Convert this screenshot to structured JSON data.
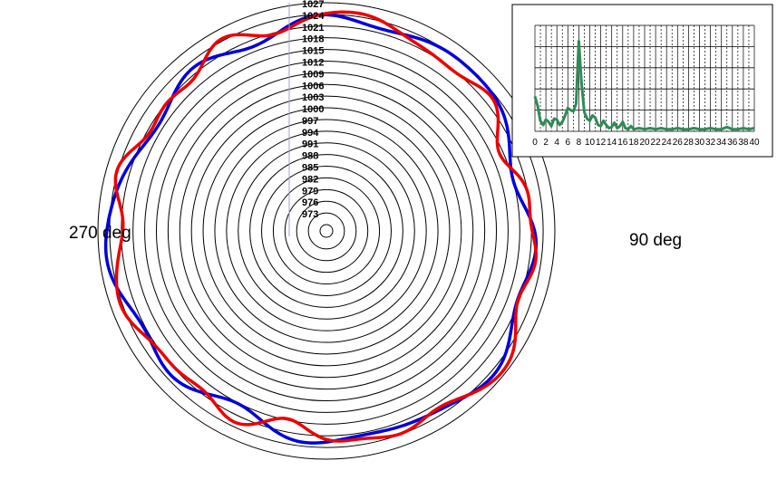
{
  "chart_data": [
    {
      "type": "polar-line",
      "radial_ticks": [
        973,
        976,
        979,
        982,
        985,
        988,
        991,
        994,
        997,
        1000,
        1003,
        1006,
        1009,
        1012,
        1015,
        1018,
        1021,
        1024,
        1027
      ],
      "rlim": [
        970,
        1027
      ],
      "labels": {
        "left": "270 deg",
        "right": "90 deg"
      },
      "series": [
        {
          "color": "#0000dd",
          "base": 1022,
          "harmonics": [
            [
              3,
              1.8,
              0.4
            ],
            [
              8,
              1.3,
              1.3
            ],
            [
              11,
              0.8,
              2.5
            ],
            [
              5,
              0.7,
              4.0
            ]
          ]
        },
        {
          "color": "#ee0000",
          "base": 1022,
          "harmonics": [
            [
              3,
              1.6,
              0.9
            ],
            [
              9,
              1.6,
              0.2
            ],
            [
              14,
              0.8,
              1.7
            ],
            [
              2,
              0.9,
              2.8
            ],
            [
              17,
              0.5,
              4.1
            ]
          ]
        }
      ]
    },
    {
      "type": "line",
      "x_ticks": [
        0,
        2,
        4,
        6,
        8,
        10,
        12,
        14,
        16,
        18,
        20,
        22,
        24,
        26,
        28,
        30,
        32,
        34,
        36,
        38,
        40
      ],
      "xlim": [
        0,
        40
      ],
      "ylim": [
        0,
        10
      ],
      "color": "#2e8b57",
      "x": [
        0,
        0.5,
        1,
        1.5,
        2,
        2.5,
        3,
        3.5,
        4,
        4.5,
        5,
        5.5,
        6,
        6.5,
        7,
        7.5,
        8,
        8.5,
        9,
        9.5,
        10,
        10.5,
        11,
        11.5,
        12,
        12.5,
        13,
        13.5,
        14,
        14.5,
        15,
        15.5,
        16,
        16.5,
        17,
        17.5,
        18,
        19,
        20,
        21,
        22,
        23,
        24,
        25,
        26,
        27,
        28,
        29,
        30,
        31,
        32,
        33,
        34,
        35,
        36,
        37,
        38,
        39,
        40
      ],
      "y": [
        3.3,
        2.4,
        1.0,
        0.6,
        1.1,
        0.9,
        0.5,
        1.2,
        1.1,
        0.6,
        0.9,
        1.5,
        2.2,
        2.0,
        1.9,
        2.6,
        8.5,
        4.5,
        1.8,
        1.2,
        1.0,
        1.5,
        1.3,
        0.6,
        0.5,
        1.0,
        0.6,
        0.3,
        0.4,
        0.8,
        0.3,
        0.5,
        0.9,
        0.3,
        0.2,
        0.5,
        0.2,
        0.3,
        0.2,
        0.3,
        0.2,
        0.3,
        0.2,
        0.2,
        0.3,
        0.2,
        0.2,
        0.3,
        0.2,
        0.2,
        0.3,
        0.2,
        0.2,
        0.4,
        0.2,
        0.2,
        0.3,
        0.2,
        0.3
      ]
    }
  ]
}
